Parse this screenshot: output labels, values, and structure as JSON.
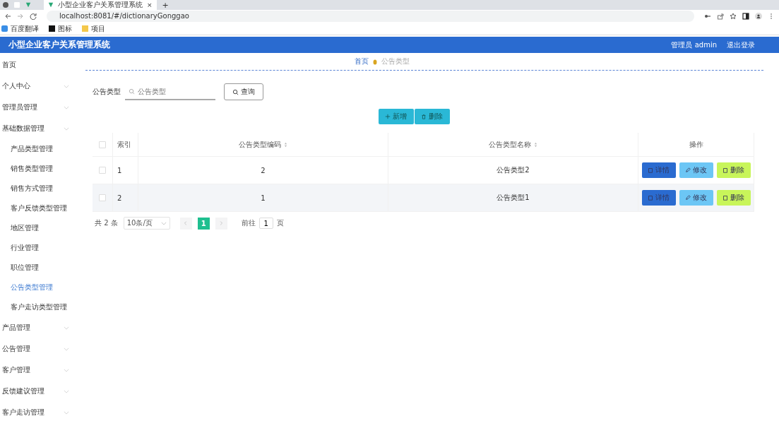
{
  "browser": {
    "tab_title": "小型企业客户关系管理系统",
    "tab_close": "×",
    "new_tab": "+",
    "url": "localhost:8081/#/dictionaryGonggao",
    "bookmarks": [
      "百度翻译",
      "图标",
      "项目"
    ]
  },
  "header": {
    "title": "小型企业客户关系管理系统",
    "user": "管理员 admin",
    "logout": "退出登录"
  },
  "sidebar": {
    "items": [
      {
        "label": "首页",
        "selected": false,
        "expandable": false
      },
      {
        "label": "个人中心",
        "selected": false,
        "expandable": true
      },
      {
        "label": "管理员管理",
        "selected": false,
        "expandable": true
      },
      {
        "label": "基础数据管理",
        "selected": false,
        "expandable": true,
        "children": [
          {
            "label": "产品类型管理",
            "selected": false
          },
          {
            "label": "销售类型管理",
            "selected": false
          },
          {
            "label": "销售方式管理",
            "selected": false
          },
          {
            "label": "客户反馈类型管理",
            "selected": false
          },
          {
            "label": "地区管理",
            "selected": false
          },
          {
            "label": "行业管理",
            "selected": false
          },
          {
            "label": "职位管理",
            "selected": false
          },
          {
            "label": "公告类型管理",
            "selected": true
          },
          {
            "label": "客户走访类型管理",
            "selected": false
          }
        ]
      },
      {
        "label": "产品管理",
        "selected": false,
        "expandable": true
      },
      {
        "label": "公告管理",
        "selected": false,
        "expandable": true
      },
      {
        "label": "客户管理",
        "selected": false,
        "expandable": true
      },
      {
        "label": "反馈建议管理",
        "selected": false,
        "expandable": true
      },
      {
        "label": "客户走访管理",
        "selected": false,
        "expandable": true
      }
    ]
  },
  "breadcrumb": [
    "首页",
    "公告类型"
  ],
  "search": {
    "label": "公告类型",
    "placeholder": "公告类型",
    "button": "查询"
  },
  "actions": [
    {
      "label": "新增",
      "kind": "add"
    },
    {
      "label": "删除",
      "kind": "delete"
    }
  ],
  "table": {
    "all_checked": false,
    "columns": [
      {
        "label": "索引",
        "sortable": false
      },
      {
        "label": "公告类型编码",
        "sortable": true
      },
      {
        "label": "公告类型名称",
        "sortable": true
      },
      {
        "label": "操作",
        "sortable": false
      }
    ],
    "rows": [
      {
        "checked": false,
        "index": "1",
        "code": "2",
        "name": "公告类型2",
        "buttons": [
          {
            "label": "详情",
            "kind": "detail"
          },
          {
            "label": "修改",
            "kind": "edit"
          },
          {
            "label": "删除",
            "kind": "delete"
          }
        ]
      },
      {
        "checked": false,
        "index": "2",
        "code": "1",
        "name": "公告类型1",
        "buttons": [
          {
            "label": "详情",
            "kind": "detail"
          },
          {
            "label": "修改",
            "kind": "edit"
          },
          {
            "label": "删除",
            "kind": "delete"
          }
        ]
      }
    ]
  },
  "pagination": {
    "total": "共 2 条",
    "page_size": "10条/页",
    "pages": [
      {
        "label": "1",
        "selected": true
      }
    ],
    "goto_label": "前往",
    "goto_value": "1",
    "goto_suffix": "页"
  }
}
